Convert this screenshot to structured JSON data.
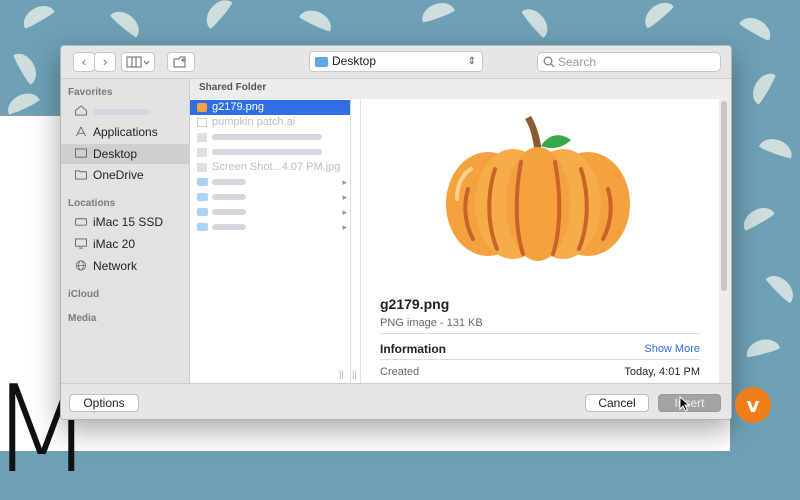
{
  "toolbar": {
    "back_icon": "chevron-left-icon",
    "forward_icon": "chevron-right-icon",
    "view_icon": "column-view-icon",
    "new_folder_icon": "new-folder-icon",
    "location": "Desktop",
    "search_placeholder": "Search"
  },
  "sidebar": {
    "favorites_heading": "Favorites",
    "favorites": [
      {
        "label": "",
        "icon": "home-icon"
      },
      {
        "label": "Applications",
        "icon": "applications-icon"
      },
      {
        "label": "Desktop",
        "icon": "desktop-icon",
        "selected": true
      },
      {
        "label": "OneDrive",
        "icon": "folder-icon"
      }
    ],
    "locations_heading": "Locations",
    "locations": [
      {
        "label": "iMac 15 SSD",
        "icon": "hard-drive-icon"
      },
      {
        "label": "iMac 20",
        "icon": "display-icon"
      },
      {
        "label": "Network",
        "icon": "network-icon"
      }
    ],
    "icloud_heading": "iCloud",
    "media_heading": "Media"
  },
  "browser": {
    "column_heading": "Shared Folder",
    "files": [
      {
        "name": "g2179.png",
        "selected": true
      },
      {
        "name": "pumpkin patch.ai",
        "dim": true
      },
      {
        "name": "",
        "blurred": true
      },
      {
        "name": "",
        "blurred": true
      },
      {
        "name": "Screen Shot...4.07 PM.jpg",
        "dim": true
      },
      {
        "name": "",
        "blurred": true,
        "folder": true
      },
      {
        "name": "",
        "blurred": true,
        "folder": true
      },
      {
        "name": "",
        "blurred": true,
        "folder": true
      },
      {
        "name": "",
        "blurred": true,
        "folder": true
      }
    ]
  },
  "preview": {
    "filename": "g2179.png",
    "kind": "PNG image - 131 KB",
    "info_heading": "Information",
    "show_more": "Show More",
    "created_label": "Created",
    "created_value": "Today, 4:01 PM"
  },
  "buttons": {
    "options": "Options",
    "cancel": "Cancel",
    "insert": "Insert"
  },
  "colors": {
    "selection": "#2f6ee3",
    "pumpkin": "#f4a23f",
    "pumpkin_rib": "#c8642a",
    "stem": "#8a5a35",
    "leaf": "#3aa84a",
    "wallpaper": "#6ea1b5",
    "brand": "#ef7d19"
  },
  "brand": {
    "icon": "vimeo-logo-icon"
  }
}
